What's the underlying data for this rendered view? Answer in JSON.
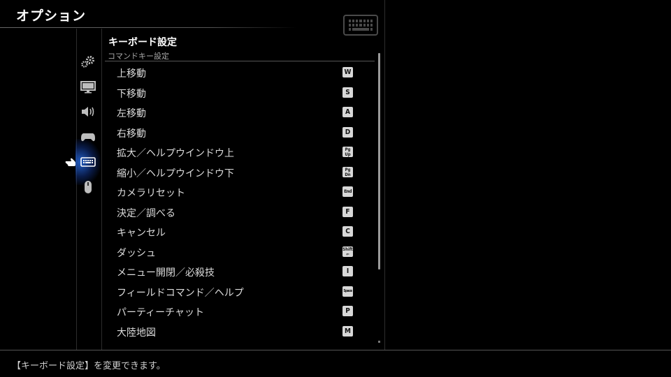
{
  "window": {
    "title": "オプション"
  },
  "section": {
    "title": "キーボード設定",
    "subtitle": "コマンドキー設定"
  },
  "sidebar": {
    "items": [
      {
        "name": "gear-icon",
        "selected": false
      },
      {
        "name": "monitor-icon",
        "selected": false
      },
      {
        "name": "speaker-icon",
        "selected": false
      },
      {
        "name": "gamepad-icon",
        "selected": false
      },
      {
        "name": "keyboard-icon",
        "selected": true
      },
      {
        "name": "mouse-icon",
        "selected": false
      }
    ]
  },
  "bindings": [
    {
      "label": "上移動",
      "key": "W"
    },
    {
      "label": "下移動",
      "key": "S"
    },
    {
      "label": "左移動",
      "key": "A"
    },
    {
      "label": "右移動",
      "key": "D"
    },
    {
      "label": "拡大／ヘルプウインドウ上",
      "key": "Pg Up"
    },
    {
      "label": "縮小／ヘルプウインドウ下",
      "key": "Pg Dn"
    },
    {
      "label": "カメラリセット",
      "key": "End"
    },
    {
      "label": "決定／調べる",
      "key": "F"
    },
    {
      "label": "キャンセル",
      "key": "C"
    },
    {
      "label": "ダッシュ",
      "key": "Shift ⇐"
    },
    {
      "label": "メニュー開閉／必殺技",
      "key": "I"
    },
    {
      "label": "フィールドコマンド／ヘルプ",
      "key": "Space"
    },
    {
      "label": "パーティーチャット",
      "key": "P"
    },
    {
      "label": "大陸地図",
      "key": "M"
    }
  ],
  "footer": {
    "help_text": "【キーボード設定】を変更できます。"
  },
  "colors": {
    "background": "#000000",
    "selection_glow": "#2a6ee6",
    "key_cap": "#d8d8d8"
  }
}
